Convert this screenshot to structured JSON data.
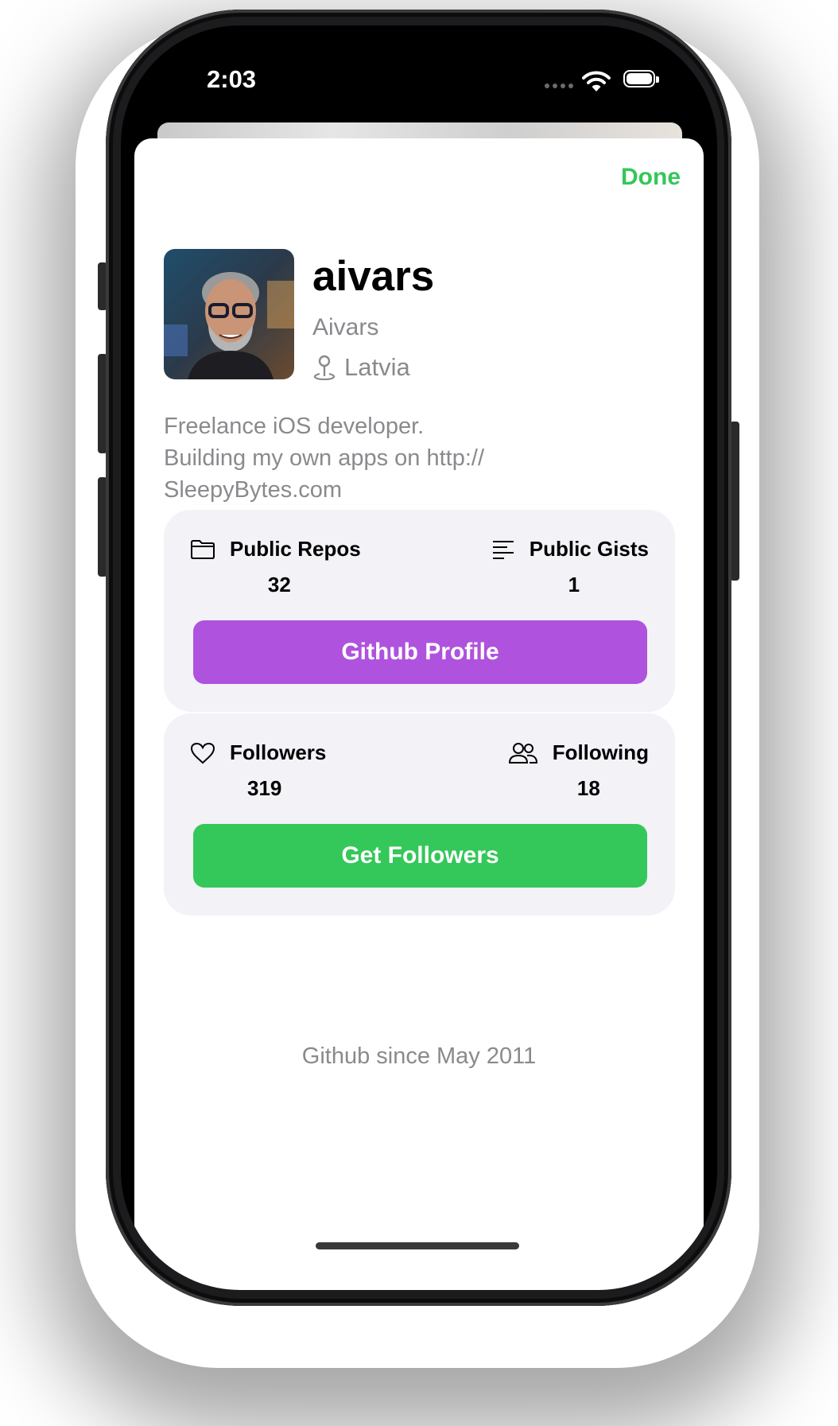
{
  "status_bar": {
    "time": "2:03"
  },
  "sheet": {
    "done_label": "Done",
    "user": {
      "username": "aivars",
      "full_name": "Aivars",
      "location": "Latvia",
      "bio": "Freelance iOS developer.\nBuilding my own apps on http://\nSleepyBytes.com"
    },
    "repo_card": {
      "public_repos": {
        "label": "Public Repos",
        "value": "32",
        "icon": "folder-icon"
      },
      "public_gists": {
        "label": "Public Gists",
        "value": "1",
        "icon": "text-lines-icon"
      },
      "button_label": "Github Profile",
      "button_color": "#af52de"
    },
    "follow_card": {
      "followers": {
        "label": "Followers",
        "value": "319",
        "icon": "heart-icon"
      },
      "following": {
        "label": "Following",
        "value": "18",
        "icon": "people-icon"
      },
      "button_label": "Get Followers",
      "button_color": "#34c759"
    },
    "member_since": "Github since May 2011"
  },
  "colors": {
    "accent": "#34c759",
    "secondary_text": "#8a8a8e",
    "card_bg": "#f2f2f7"
  }
}
